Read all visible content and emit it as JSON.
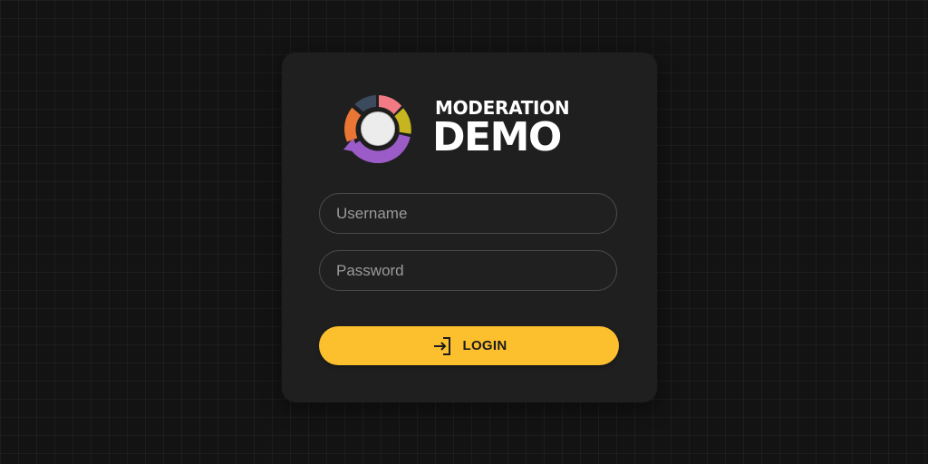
{
  "brand": {
    "title_top": "MODERATION",
    "title_bottom": "DEMO",
    "logo_icon": "moderation-logo-icon",
    "logo_colors": [
      "#3c4a5e",
      "#f27a84",
      "#c7b51f",
      "#9b5cc7",
      "#e97634",
      "#ececec"
    ]
  },
  "form": {
    "username_placeholder": "Username",
    "password_placeholder": "Password",
    "login_label": "LOGIN",
    "login_icon": "login-icon"
  },
  "colors": {
    "background": "#131313",
    "card": "#1f1f1f",
    "accent": "#fcc02e",
    "field_border": "#4a4a4a"
  }
}
